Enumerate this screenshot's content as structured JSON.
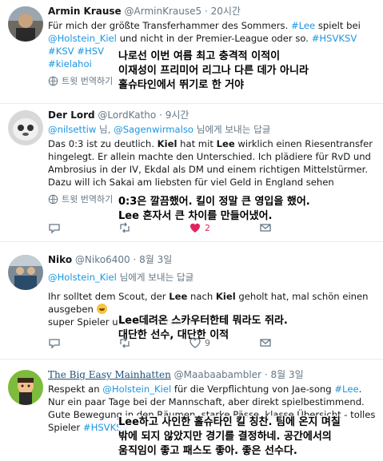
{
  "common": {
    "translate_label": "트윗 번역하기"
  },
  "tweets": [
    {
      "name": "Armin Krause",
      "handle": "@ArminKrause5",
      "dot": "·",
      "time": "20시간",
      "text_1": "Für mich der größte Transferhammer des Sommers. ",
      "hashtag_lee": "#Lee",
      "text_2": " spielt bei",
      "mention_kiel": "@Holstein_Kiel",
      "text_3": " und nicht in der Premier-League oder so. ",
      "hashtags_line2": "#HSVKSV #KSV #HSV",
      "hashtag_kielahoi": "#kielahoi",
      "overlay": [
        "나로선 이번 여름 최고 충격적 이적이",
        "이재성이 프리미어 리그나 다른 데가 아니라",
        "홀슈타인에서 뛰기로 한 거야"
      ]
    },
    {
      "name": "Der Lord",
      "handle": "@LordKatho",
      "dot": "·",
      "time": "9시간",
      "reply_mention_1": "@nilsettiw",
      "reply_mid": " 님, ",
      "reply_mention_2": "@Sagenwirmalso",
      "reply_suffix": " 님에게 보내는 답글",
      "text_a": "Das 0:3 ist zu deutlich. ",
      "kiel": "Kiel",
      "text_b": " hat mit ",
      "lee": "Lee",
      "text_c": " wirklich einen Riesentransfer hingelegt. Er allein machte den Unterschied. Ich plädiere für RvD und Ambrosius in der IV, Ekdal als DM und einem richtigen Mittelstürmer. Dazu will ich Sakai am liebsten für viel Geld in England sehen",
      "likes": "2",
      "overlay": [
        "0:3은 깔끔했어. 킬이 정말 큰 영입을 했어.",
        "Lee 혼자서 큰 차이를 만들어냈어."
      ]
    },
    {
      "name": "Niko",
      "handle": "@Niko6400",
      "dot": "·",
      "time": "8월 3일",
      "reply_mention": "@Holstein_Kiel",
      "reply_suffix": " 님에게 보내는 답글",
      "text_a": "Ihr solltet dem Scout, der ",
      "lee": "Lee",
      "text_b": " nach ",
      "kiel": "Kiel",
      "text_c": " geholt hat, mal schön einen ausgeben ",
      "text_d": "super Spieler und super Transfer",
      "likes": "9",
      "overlay": [
        "Lee데려온 스카우터한테 뭐라도 쥐라.",
        "대단한 선수, 대단한 이적"
      ]
    },
    {
      "name": "The Big Easy Mainhatten",
      "handle": "@Maabaabambler",
      "dot": "·",
      "time": "8월 3일",
      "text_a": "Respekt an ",
      "mention_kiel": "@Holstein_Kiel",
      "text_b": " für die Verpflichtung von Jae-song ",
      "hashtag_lee": "#Lee",
      "text_c": ". Nur ein paar Tage bei der Mannschaft, aber direkt spielbestimmend. Gute Bewegung in den Räumen, starke Pässe, klasse Übersicht - tolles Spieler ",
      "hashtag_hsvksv": "#HSVKSV",
      "overlay": [
        "Lee하고 사인한 홀슈타인 킬 칭찬. 팀에 온지 며칠",
        "밖에 되지 않았지만 경기를 결정하네. 공간에서의",
        "움직임이 좋고 패스도 좋아. 좋은 선수다."
      ]
    }
  ]
}
